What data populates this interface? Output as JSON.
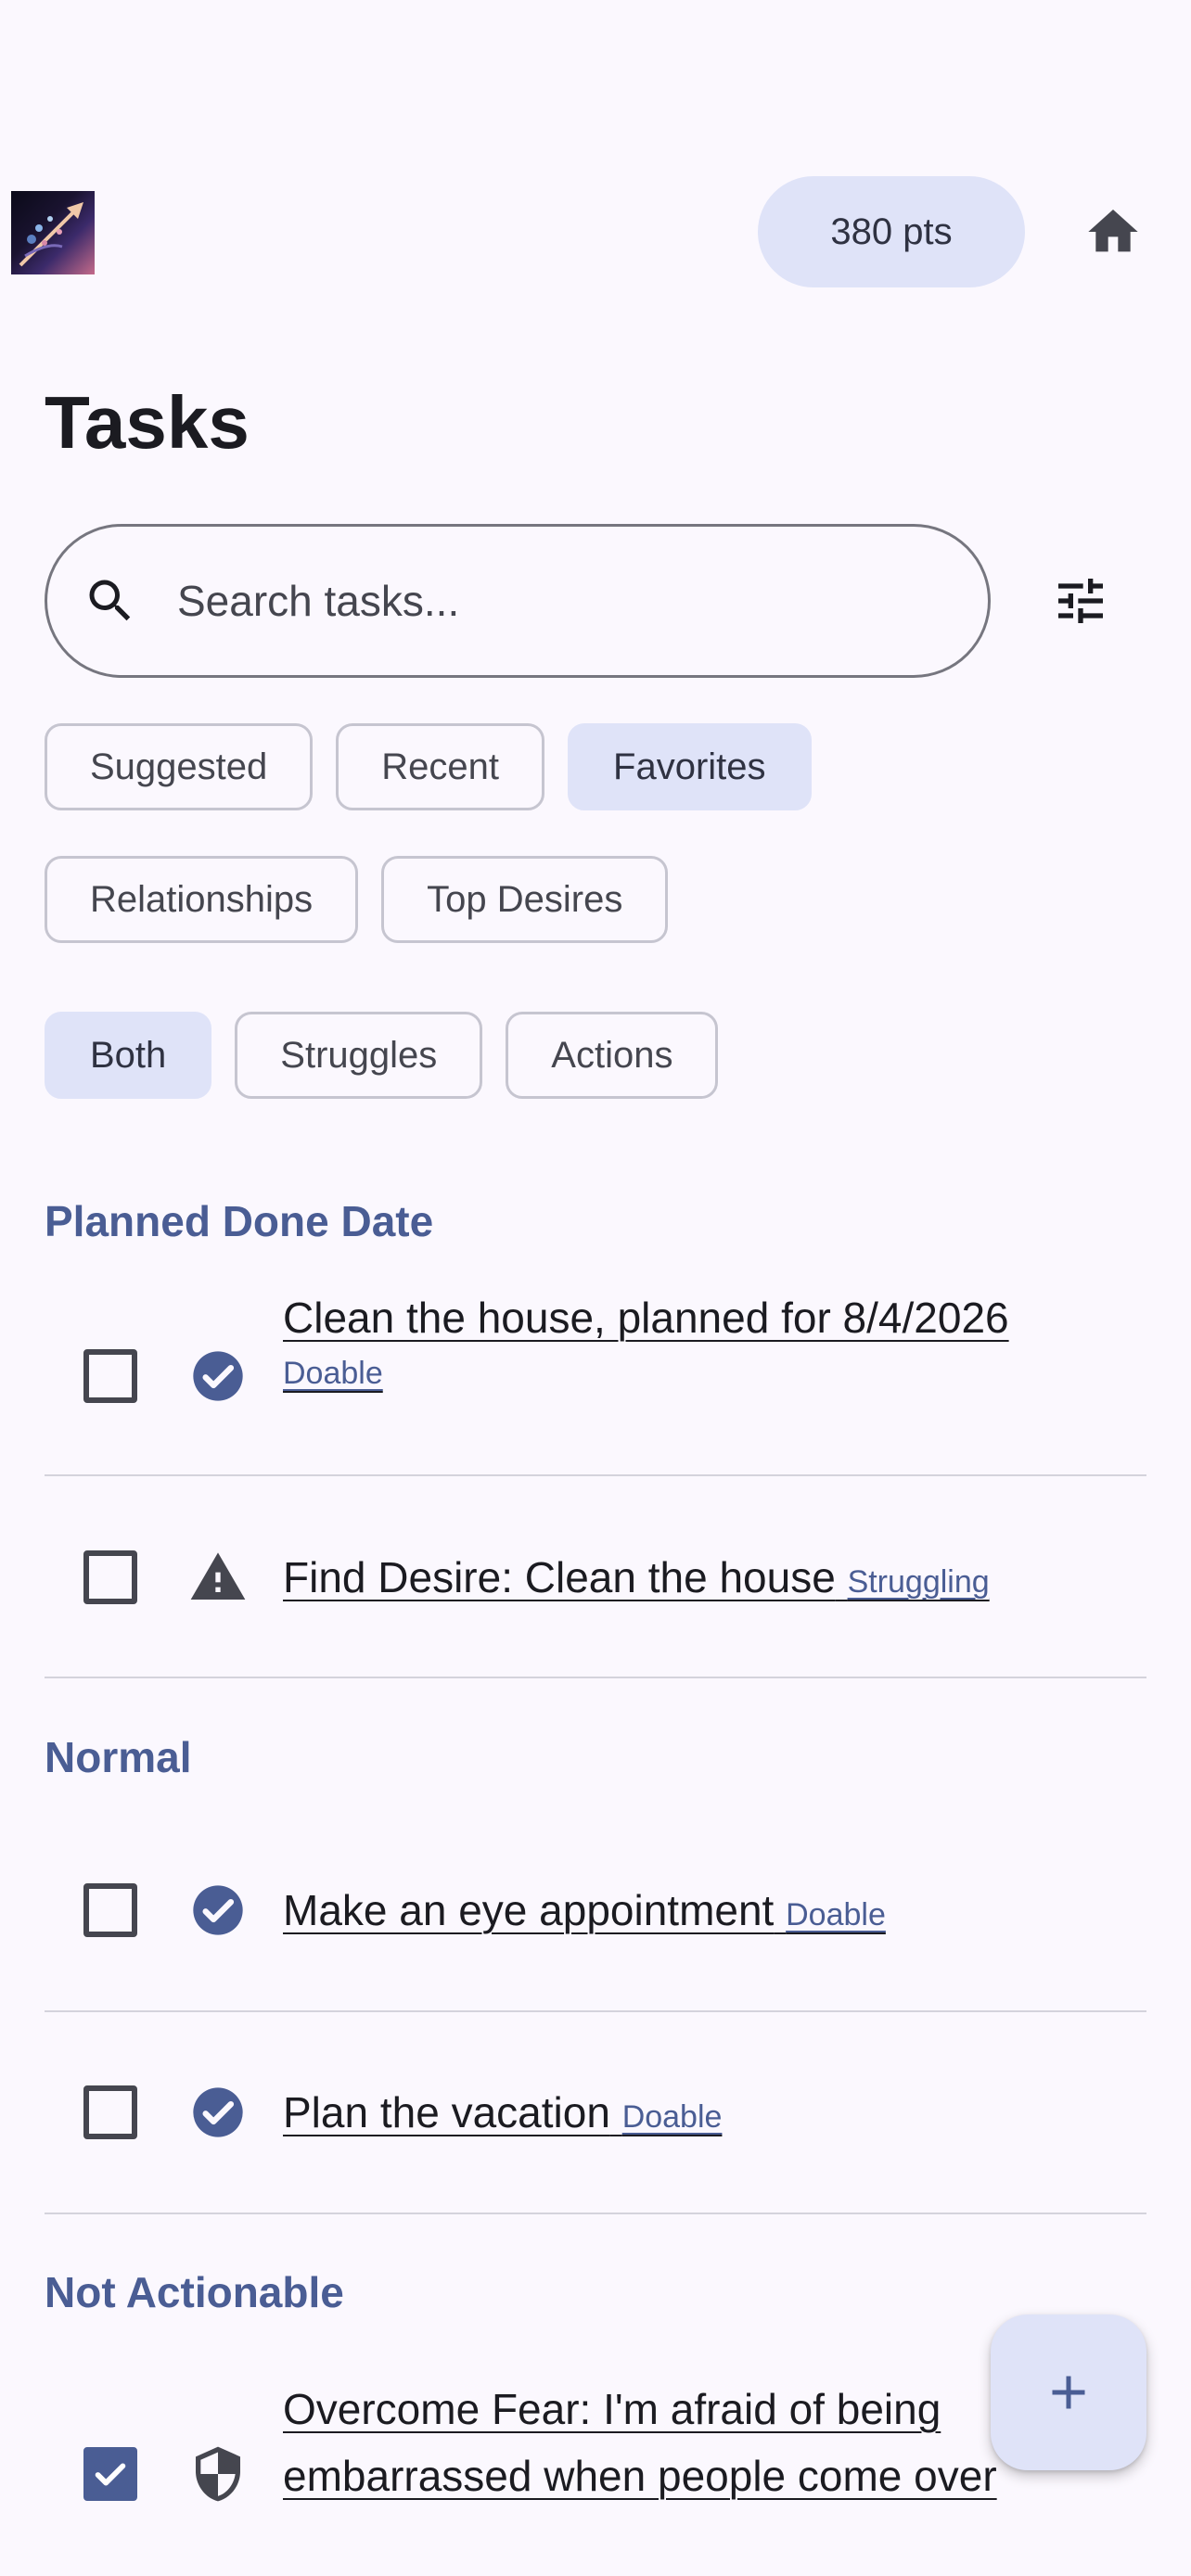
{
  "header": {
    "points": "380 pts",
    "home_icon": "home-icon",
    "logo_icon": "app-logo"
  },
  "title": "Tasks",
  "search": {
    "placeholder": "Search tasks...",
    "value": "",
    "icon": "search-icon",
    "filter_icon": "tune-icon"
  },
  "filters": {
    "row1": [
      "Suggested",
      "Recent",
      "Favorites"
    ],
    "row2": [
      "Relationships",
      "Top Desires"
    ],
    "row3": [
      "Both",
      "Struggles",
      "Actions"
    ],
    "selected_list": "Favorites",
    "selected_type": "Both"
  },
  "sections": [
    {
      "title": "Planned Done Date",
      "tasks": [
        {
          "text": "Clean the house, planned for 8/4/2026",
          "tag": "Doable",
          "checked": false,
          "status_icon": "check-circle-icon"
        },
        {
          "text": "Find Desire: Clean the house",
          "tag": "Struggling",
          "checked": false,
          "status_icon": "warning-icon"
        }
      ]
    },
    {
      "title": "Normal",
      "tasks": [
        {
          "text": "Make an eye appointment",
          "tag": "Doable",
          "checked": false,
          "status_icon": "check-circle-icon"
        },
        {
          "text": "Plan the vacation",
          "tag": "Doable",
          "checked": false,
          "status_icon": "check-circle-icon"
        }
      ]
    },
    {
      "title": "Not Actionable",
      "tasks": [
        {
          "text": "Overcome Fear: I'm afraid of being embarrassed when people come over",
          "tag": "",
          "checked": true,
          "status_icon": "shield-icon"
        }
      ]
    }
  ],
  "fab": {
    "icon": "add-icon"
  },
  "colors": {
    "background": "#fbf8fe",
    "accent": "#4a5d94",
    "chip_selected": "#dfe3f8",
    "text": "#1b1b21"
  }
}
